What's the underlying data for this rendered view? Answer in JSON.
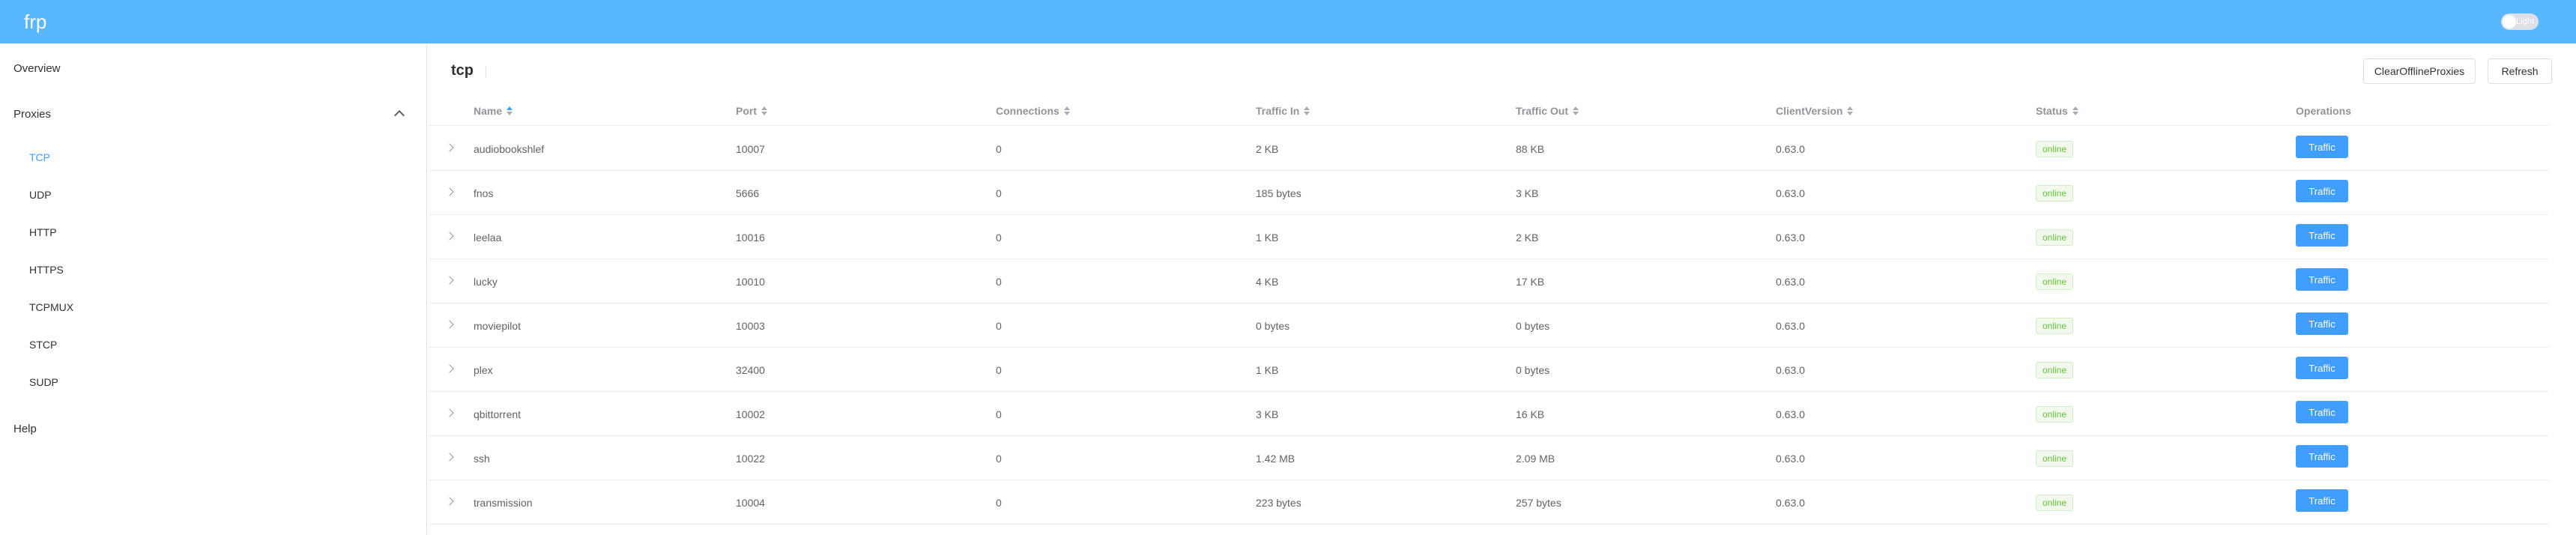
{
  "header": {
    "brand": "frp",
    "theme_label": "Light"
  },
  "sidebar": {
    "overview": "Overview",
    "proxies": "Proxies",
    "items": [
      "TCP",
      "UDP",
      "HTTP",
      "HTTPS",
      "TCPMUX",
      "STCP",
      "SUDP"
    ],
    "active": "TCP",
    "help": "Help"
  },
  "main": {
    "title": "tcp",
    "clear_label": "ClearOfflineProxies",
    "refresh_label": "Refresh",
    "columns": [
      "Name",
      "Port",
      "Connections",
      "Traffic In",
      "Traffic Out",
      "ClientVersion",
      "Status",
      "Operations"
    ],
    "operation_label": "Traffic",
    "rows": [
      {
        "name": "audiobookshlef",
        "port": "10007",
        "connections": "0",
        "traffic_in": "2 KB",
        "traffic_out": "88 KB",
        "version": "0.63.0",
        "status": "online"
      },
      {
        "name": "fnos",
        "port": "5666",
        "connections": "0",
        "traffic_in": "185 bytes",
        "traffic_out": "3 KB",
        "version": "0.63.0",
        "status": "online"
      },
      {
        "name": "leelaa",
        "port": "10016",
        "connections": "0",
        "traffic_in": "1 KB",
        "traffic_out": "2 KB",
        "version": "0.63.0",
        "status": "online"
      },
      {
        "name": "lucky",
        "port": "10010",
        "connections": "0",
        "traffic_in": "4 KB",
        "traffic_out": "17 KB",
        "version": "0.63.0",
        "status": "online"
      },
      {
        "name": "moviepilot",
        "port": "10003",
        "connections": "0",
        "traffic_in": "0 bytes",
        "traffic_out": "0 bytes",
        "version": "0.63.0",
        "status": "online"
      },
      {
        "name": "plex",
        "port": "32400",
        "connections": "0",
        "traffic_in": "1 KB",
        "traffic_out": "0 bytes",
        "version": "0.63.0",
        "status": "online"
      },
      {
        "name": "qbittorrent",
        "port": "10002",
        "connections": "0",
        "traffic_in": "3 KB",
        "traffic_out": "16 KB",
        "version": "0.63.0",
        "status": "online"
      },
      {
        "name": "ssh",
        "port": "10022",
        "connections": "0",
        "traffic_in": "1.42 MB",
        "traffic_out": "2.09 MB",
        "version": "0.63.0",
        "status": "online"
      },
      {
        "name": "transmission",
        "port": "10004",
        "connections": "0",
        "traffic_in": "223 bytes",
        "traffic_out": "257 bytes",
        "version": "0.63.0",
        "status": "online"
      }
    ]
  }
}
